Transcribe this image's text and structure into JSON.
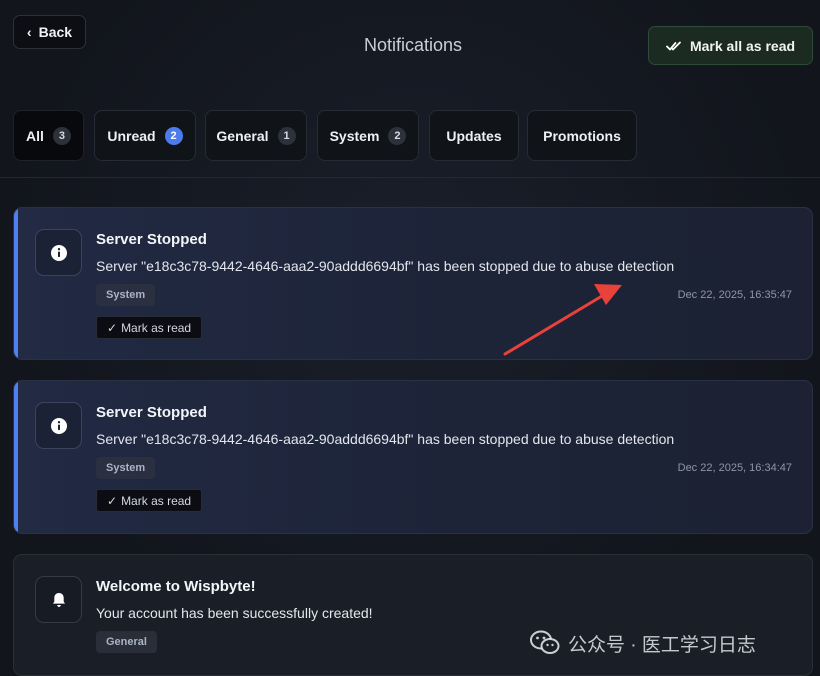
{
  "header": {
    "back_label": "Back",
    "title": "Notifications",
    "mark_all_label": "Mark all as read"
  },
  "tabs": [
    {
      "label": "All",
      "count": "3",
      "active": true
    },
    {
      "label": "Unread",
      "count": "2"
    },
    {
      "label": "General",
      "count": "1"
    },
    {
      "label": "System",
      "count": "2"
    },
    {
      "label": "Updates"
    },
    {
      "label": "Promotions"
    }
  ],
  "notifications": [
    {
      "title": "Server Stopped",
      "message": "Server \"e18c3c78-9442-4646-aaa2-90addd6694bf\" has been stopped due to abuse detection",
      "tag": "System",
      "timestamp": "Dec 22, 2025, 16:35:47",
      "action": "Mark as read",
      "icon": "info-icon",
      "unread": true
    },
    {
      "title": "Server Stopped",
      "message": "Server \"e18c3c78-9442-4646-aaa2-90addd6694bf\" has been stopped due to abuse detection",
      "tag": "System",
      "timestamp": "Dec 22, 2025, 16:34:47",
      "action": "Mark as read",
      "icon": "info-icon",
      "unread": true
    },
    {
      "title": "Welcome to Wispbyte!",
      "message": "Your account has been successfully created!",
      "tag": "General",
      "icon": "bell-icon",
      "unread": false
    }
  ],
  "watermark": {
    "text": "公众号 · 医工学习日志"
  },
  "colors": {
    "accent": "#4f7ff0",
    "badge_blue": "#4b7bec",
    "annotation_arrow": "#e8423b",
    "mark_all_bg": "#1b2b22"
  }
}
